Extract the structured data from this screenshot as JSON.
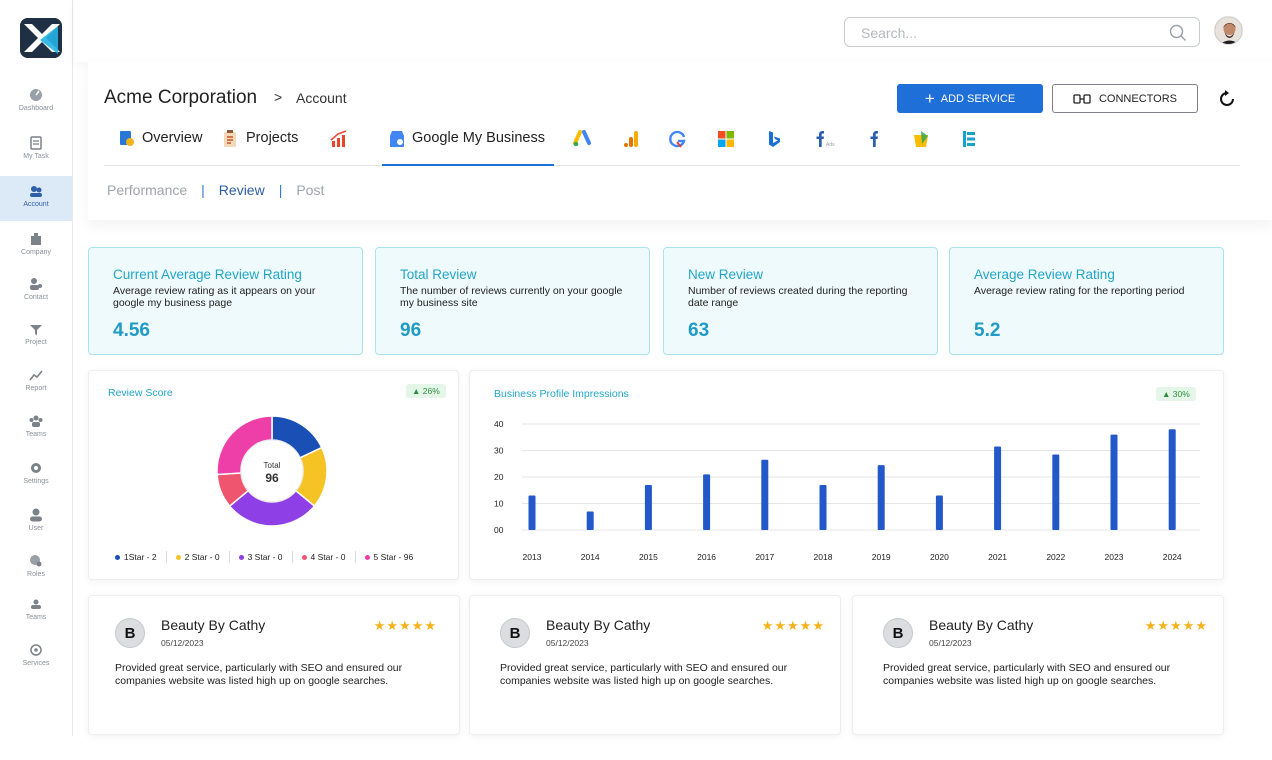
{
  "sidebar": {
    "items": [
      {
        "label": "Dashboard",
        "icon": "dashboard-icon"
      },
      {
        "label": "My Task",
        "icon": "task-icon"
      },
      {
        "label": "Account",
        "icon": "account-icon",
        "active": true
      },
      {
        "label": "Company",
        "icon": "company-icon"
      },
      {
        "label": "Contact",
        "icon": "contact-icon"
      },
      {
        "label": "Project",
        "icon": "project-icon"
      },
      {
        "label": "Report",
        "icon": "report-icon"
      },
      {
        "label": "Teams",
        "icon": "teams-icon"
      },
      {
        "label": "Settings",
        "icon": "settings-icon"
      },
      {
        "label": "User",
        "icon": "user-icon"
      },
      {
        "label": "Roles",
        "icon": "roles-icon"
      },
      {
        "label": "Teams",
        "icon": "teams-icon"
      },
      {
        "label": "Services",
        "icon": "services-icon"
      }
    ]
  },
  "search": {
    "placeholder": "Search...",
    "value": ""
  },
  "breadcrumb": {
    "main": "Acme Corporation",
    "separator": ">",
    "sub": "Account"
  },
  "actions": {
    "add_service": "ADD SERVICE",
    "connectors": "CONNECTORS"
  },
  "tabs": [
    {
      "label": "Overview",
      "icon": "overview-icon"
    },
    {
      "label": "Projects",
      "icon": "projects-icon"
    },
    {
      "label": "",
      "icon": "analytics-icon"
    },
    {
      "label": "Google My Business",
      "icon": "google-my-business-icon",
      "active": true
    },
    {
      "label": "",
      "icon": "google-ads-icon"
    },
    {
      "label": "",
      "icon": "google-analytics-icon"
    },
    {
      "label": "",
      "icon": "google-search-console-icon"
    },
    {
      "label": "",
      "icon": "microsoft-icon"
    },
    {
      "label": "",
      "icon": "bing-icon"
    },
    {
      "label": "",
      "icon": "facebook-ads-icon"
    },
    {
      "label": "",
      "icon": "facebook-icon"
    },
    {
      "label": "",
      "icon": "shopping-icon"
    },
    {
      "label": "",
      "icon": "tag-manager-icon"
    }
  ],
  "subtabs": [
    "Performance",
    "Review",
    "Post"
  ],
  "kpis": [
    {
      "title": "Current Average Review Rating",
      "desc": "Average review rating as it appears on your google my business page",
      "value": "4.56"
    },
    {
      "title": "Total Review",
      "desc": "The number of reviews currently on your google my business site",
      "value": "96"
    },
    {
      "title": "New Review",
      "desc": "Number of reviews created during the reporting date range",
      "value": "63"
    },
    {
      "title": "Average Review Rating",
      "desc": "Average review rating for the reporting period",
      "value": "5.2"
    }
  ],
  "review_score": {
    "title": "Review Score",
    "badge": "▲ 26%",
    "center_label": "Total",
    "center_value": "96",
    "legend": [
      "1Star - 2",
      "2 Star - 0",
      "3 Star - 0",
      "4 Star - 0",
      "5 Star - 96"
    ]
  },
  "impressions": {
    "title": "Business Profile Impressions",
    "badge": "▲ 30%"
  },
  "chart_data": [
    {
      "type": "pie",
      "title": "Review Score",
      "categories": [
        "1Star",
        "2 Star",
        "3 Star",
        "4 Star",
        "5 Star"
      ],
      "values": [
        2,
        0,
        0,
        0,
        96
      ],
      "colors": [
        "#1f6fd9",
        "#f6c325",
        "#8e3fe6",
        "#f0556f",
        "#ee3ea8"
      ],
      "display_slices": [
        {
          "color": "#1a4fb5",
          "pct": 0.18
        },
        {
          "color": "#f6c325",
          "pct": 0.18
        },
        {
          "color": "#8e3fe6",
          "pct": 0.28
        },
        {
          "color": "#f0556f",
          "pct": 0.1
        },
        {
          "color": "#ee3ea8",
          "pct": 0.26
        }
      ]
    },
    {
      "type": "bar",
      "title": "Business Profile Impressions",
      "categories": [
        "2013",
        "2014",
        "2015",
        "2016",
        "2017",
        "2018",
        "2019",
        "2020",
        "2021",
        "2022",
        "2023",
        "2024"
      ],
      "values": [
        13,
        7,
        17,
        21,
        26.5,
        17,
        24.5,
        13,
        31.5,
        28.5,
        36,
        38
      ],
      "ytick_labels": [
        "00",
        "10",
        "20",
        "30",
        "40"
      ],
      "ytick_values": [
        0,
        10,
        20,
        30,
        40
      ],
      "ylim": [
        0,
        40
      ],
      "color": "#2358c9",
      "grid": true
    }
  ],
  "reviews": [
    {
      "initial": "B",
      "name": "Beauty By Cathy",
      "date": "05/12/2023",
      "stars": "★★★★★",
      "text": "Provided great service, particularly with SEO and ensured our companies website was listed high up on google searches."
    },
    {
      "initial": "B",
      "name": "Beauty By Cathy",
      "date": "05/12/2023",
      "stars": "★★★★★",
      "text": "Provided great service, particularly with SEO and ensured our companies website was listed high up on google searches."
    },
    {
      "initial": "B",
      "name": "Beauty By Cathy",
      "date": "05/12/2023",
      "stars": "★★★★★",
      "text": "Provided great service, particularly with SEO and ensured our companies website was listed high up on google searches."
    }
  ]
}
